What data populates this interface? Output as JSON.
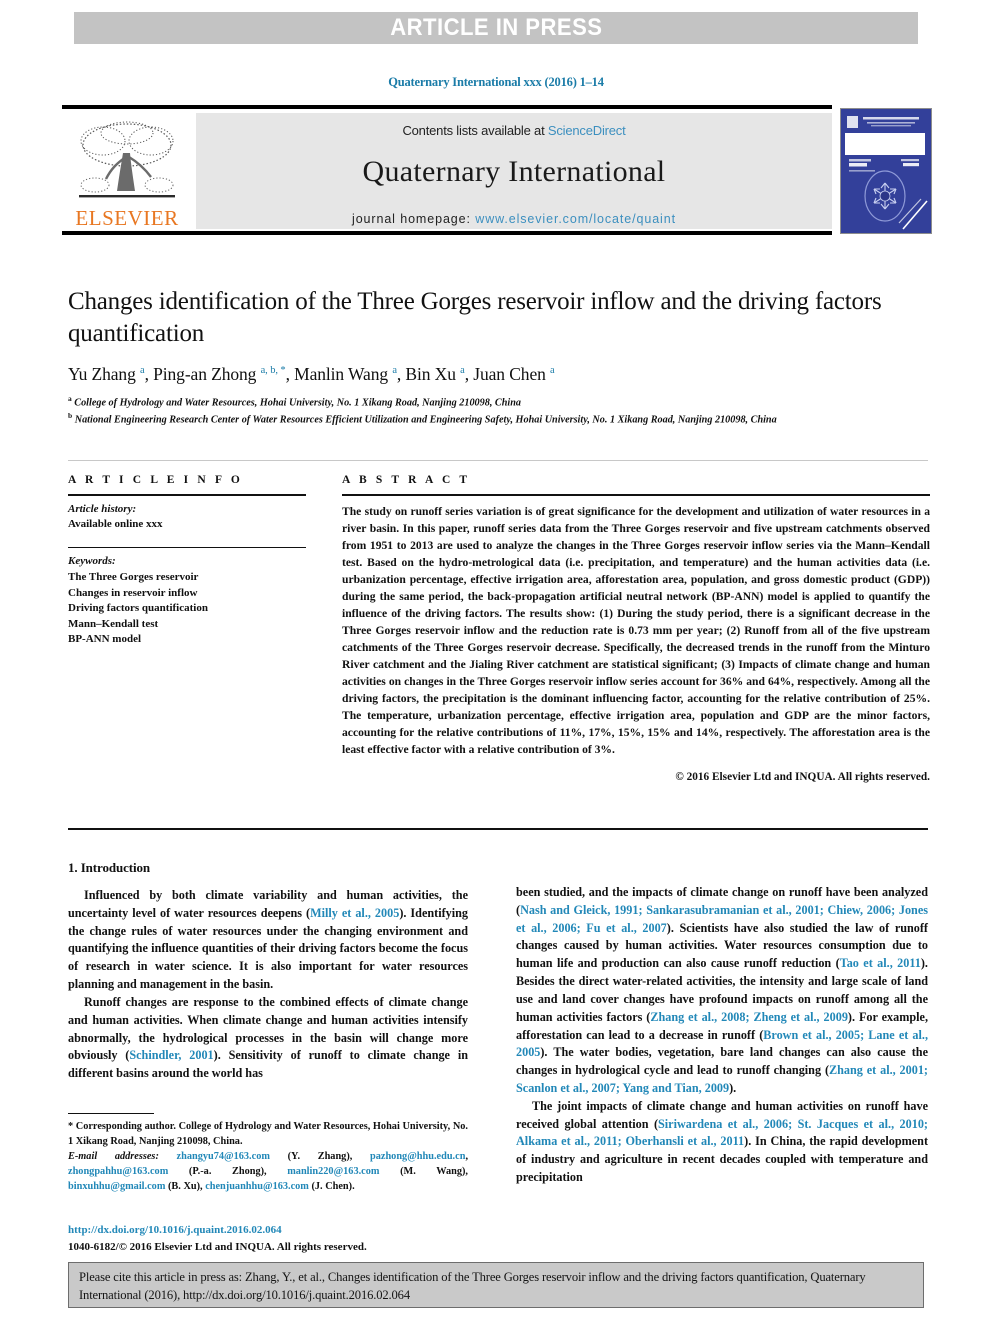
{
  "banner": {
    "text": "ARTICLE IN PRESS"
  },
  "journal_ref": "Quaternary International xxx (2016) 1–14",
  "masthead": {
    "contents_prefix": "Contents lists available at ",
    "contents_link": "ScienceDirect",
    "journal_title": "Quaternary International",
    "homepage_prefix": "journal homepage: ",
    "homepage_url": "www.elsevier.com/locate/quaint",
    "publisher": "ELSEVIER",
    "publisher_logo_icon": "elsevier-tree-icon",
    "cover_icon": "journal-cover-thumbnail"
  },
  "article": {
    "title": "Changes identification of the Three Gorges reservoir inflow and the driving factors quantification",
    "authors_html": "Yu Zhang <sup>a</sup>, Ping-an Zhong <sup>a, b, *</sup>, Manlin Wang <sup>a</sup>, Bin Xu <sup>a</sup>, Juan Chen <sup>a</sup>",
    "affiliation_a": "College of Hydrology and Water Resources, Hohai University, No. 1 Xikang Road, Nanjing 210098, China",
    "affiliation_b": "National Engineering Research Center of Water Resources Efficient Utilization and Engineering Safety, Hohai University, No. 1 Xikang Road, Nanjing 210098, China"
  },
  "article_info": {
    "heading": "A R T I C L E   I N F O",
    "history_label": "Article history:",
    "history_value": "Available online xxx",
    "keywords_label": "Keywords:",
    "keywords": [
      "The Three Gorges reservoir",
      "Changes in reservoir inflow",
      "Driving factors quantification",
      "Mann–Kendall test",
      "BP-ANN model"
    ]
  },
  "abstract": {
    "heading": "A B S T R A C T",
    "text": "The study on runoff series variation is of great significance for the development and utilization of water resources in a river basin. In this paper, runoff series data from the Three Gorges reservoir and five upstream catchments observed from 1951 to 2013 are used to analyze the changes in the Three Gorges reservoir inflow series via the Mann–Kendall test. Based on the hydro-metrological data (i.e. precipitation, and temperature) and the human activities data (i.e. urbanization percentage, effective irrigation area, afforestation area, population, and gross domestic product (GDP)) during the same period, the back-propagation artificial neutral network (BP-ANN) model is applied to quantify the influence of the driving factors. The results show: (1) During the study period, there is a significant decrease in the Three Gorges reservoir inflow and the reduction rate is 0.73 mm per year; (2) Runoff from all of the five upstream catchments of the Three Gorges reservoir decrease. Specifically, the decreased trends in the runoff from the Minturo River catchment and the Jialing River catchment are statistical significant; (3) Impacts of climate change and human activities on changes in the Three Gorges reservoir inflow series account for 36% and 64%, respectively. Among all the driving factors, the precipitation is the dominant influencing factor, accounting for the relative contribution of 25%. The temperature, urbanization percentage, effective irrigation area, population and GDP are the minor factors, accounting for the relative contributions of 11%, 17%, 15%, 15% and 14%, respectively. The afforestation area is the least effective factor with a relative contribution of 3%.",
    "copyright": "© 2016 Elsevier Ltd and INQUA. All rights reserved."
  },
  "introduction": {
    "heading": "1. Introduction",
    "left_paragraphs": [
      "Influenced by both climate variability and human activities, the uncertainty level of water resources deepens (<span class=\"ref\">Milly et al., 2005</span>). Identifying the change rules of water resources under the changing environment and quantifying the influence quantities of their driving factors become the focus of research in water science. It is also important for water resources planning and management in the basin.",
      "Runoff changes are response to the combined effects of climate change and human activities. When climate change and human activities intensify abnormally, the hydrological processes in the basin will change more obviously (<span class=\"ref\">Schindler, 2001</span>). Sensitivity of runoff to climate change in different basins around the world has"
    ],
    "right_paragraphs": [
      "been studied, and the impacts of climate change on runoff have been analyzed (<span class=\"ref\">Nash and Gleick, 1991; Sankarasubramanian et al., 2001; Chiew, 2006; Jones et al., 2006; Fu et al., 2007</span>). Scientists have also studied the law of runoff changes caused by human activities. Water resources consumption due to human life and production can also cause runoff reduction (<span class=\"ref\">Tao et al., 2011</span>). Besides the direct water-related activities, the intensity and large scale of land use and land cover changes have profound impacts on runoff among all the human activities factors (<span class=\"ref\">Zhang et al., 2008; Zheng et al., 2009</span>). For example, afforestation can lead to a decrease in runoff (<span class=\"ref\">Brown et al., 2005; Lane et al., 2005</span>). The water bodies, vegetation, bare land changes can also cause the changes in hydrological cycle and lead to runoff changing (<span class=\"ref\">Zhang et al., 2001; Scanlon et al., 2007; Yang and Tian, 2009</span>).",
      "The joint impacts of climate change and human activities on runoff have received global attention (<span class=\"ref\">Siriwardena et al., 2006; St. Jacques et al., 2010; Alkama et al., 2011; Oberhansli et al., 2011</span>). In China, the rapid development of industry and agriculture in recent decades coupled with temperature and precipitation"
    ]
  },
  "footnotes": {
    "corresponding": "* Corresponding author. College of Hydrology and Water Resources, Hohai University, No. 1 Xikang Road, Nanjing 210098, China.",
    "email_label": "E-mail addresses:",
    "emails_html": "<span class=\"ref\">zhangyu74@163.com</span> (Y. Zhang), <span class=\"ref\">pazhong@hhu.edu.cn</span>, <span class=\"ref\">zhongpahhu@163.com</span> (P.-a. Zhong), <span class=\"ref\">manlin220@163.com</span> (M. Wang), <span class=\"ref\">binxuhhu@gmail.com</span> (B. Xu), <span class=\"ref\">chenjuanhhu@163.com</span> (J. Chen)."
  },
  "doi": {
    "link": "http://dx.doi.org/10.1016/j.quaint.2016.02.064",
    "issn_line": "1040-6182/© 2016 Elsevier Ltd and INQUA. All rights reserved."
  },
  "cite_box": {
    "text": "Please cite this article in press as: Zhang, Y., et al., Changes identification of the Three Gorges reservoir inflow and the driving factors quantification, Quaternary International (2016), http://dx.doi.org/10.1016/j.quaint.2016.02.064"
  },
  "colors": {
    "link": "#2288b8",
    "banner_bg": "#c3c3c3",
    "masthead_bg": "#e6e6e6",
    "elsevier_orange": "#e87722",
    "cover_blue": "#33409a"
  }
}
